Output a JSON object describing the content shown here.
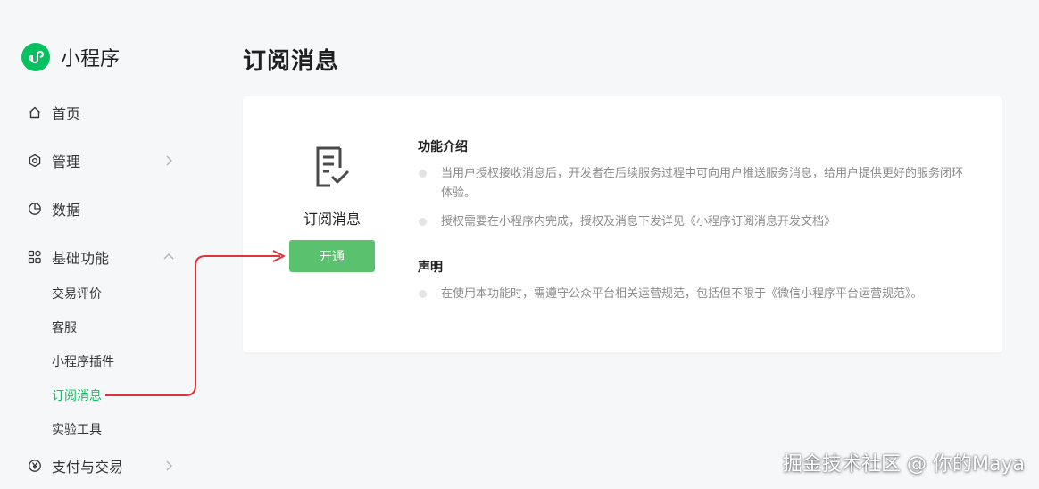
{
  "brand": {
    "name": "小程序",
    "logo_icon": "miniprogram-logo-icon",
    "logo_color": "#07c160"
  },
  "sidebar": {
    "items": [
      {
        "label": "首页",
        "icon": "home-icon"
      },
      {
        "label": "管理",
        "icon": "hexagon-icon",
        "expandable": true
      },
      {
        "label": "数据",
        "icon": "pie-chart-icon"
      },
      {
        "label": "基础功能",
        "icon": "grid-icon",
        "expanded": true
      },
      {
        "label": "支付与交易",
        "icon": "yen-icon",
        "expandable": true
      }
    ],
    "sub_items": [
      {
        "label": "交易评价"
      },
      {
        "label": "客服"
      },
      {
        "label": "小程序插件"
      },
      {
        "label": "订阅消息",
        "active": true
      },
      {
        "label": "实验工具"
      }
    ],
    "active_color": "#07c160"
  },
  "main": {
    "title": "订阅消息",
    "card": {
      "feature_icon": "document-check-icon",
      "feature_name": "订阅消息",
      "open_button": "开通",
      "button_color": "#5ac26f",
      "intro_title": "功能介绍",
      "intro_bullets": [
        "当用户授权接收消息后，开发者在后续服务过程中可向用户推送服务消息，给用户提供更好的服务闭环体验。",
        "授权需要在小程序内完成，授权及消息下发详见《小程序订阅消息开发文档》"
      ],
      "statement_title": "声明",
      "statement_bullets": [
        "在使用本功能时，需遵守公众平台相关运营规范，包括但不限于《微信小程序平台运营规范》。"
      ]
    }
  },
  "annotation": {
    "color": "#e0333a"
  },
  "watermark": "掘金技术社区 @ 你的Maya"
}
